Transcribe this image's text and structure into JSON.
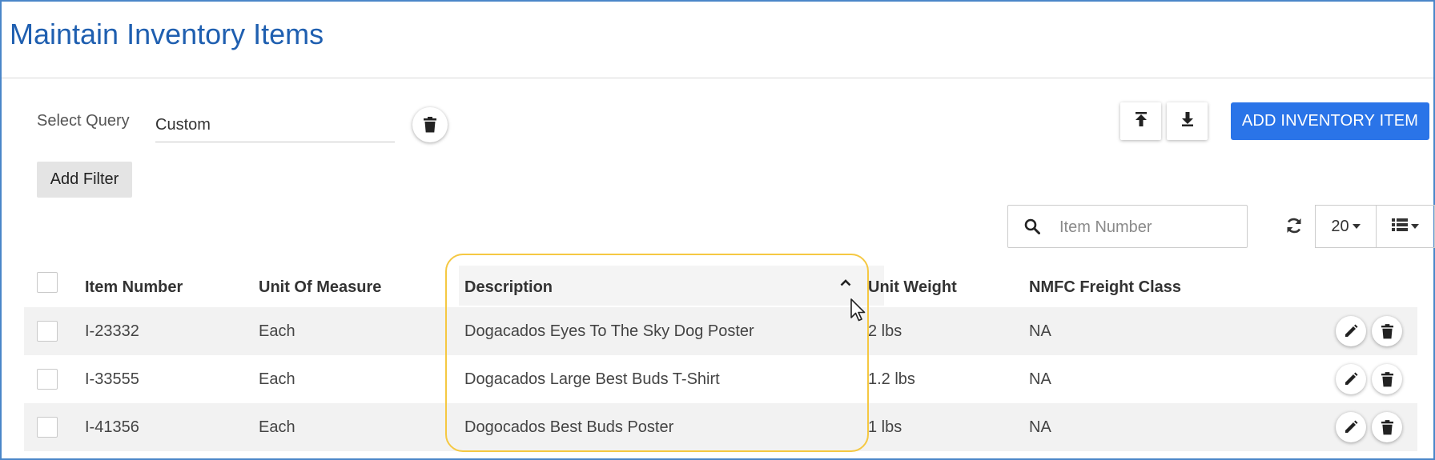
{
  "page": {
    "title": "Maintain Inventory Items"
  },
  "query": {
    "label": "Select Query",
    "value": "Custom",
    "delete_icon": "trash-icon"
  },
  "filters": {
    "add_filter_label": "Add Filter"
  },
  "toolbar": {
    "upload_icon": "upload-icon",
    "download_icon": "download-icon",
    "add_item_label": "ADD INVENTORY ITEM"
  },
  "search": {
    "placeholder": "Item Number",
    "icon": "search-icon"
  },
  "table_controls": {
    "refresh_icon": "refresh-icon",
    "page_size": "20",
    "view_icon": "list-icon"
  },
  "table": {
    "columns": {
      "item_number": "Item Number",
      "unit_of_measure": "Unit Of Measure",
      "description": "Description",
      "unit_weight": "Unit Weight",
      "nmfc_freight_class": "NMFC Freight Class"
    },
    "sorted_column": "description",
    "sort_direction": "ascending",
    "rows": [
      {
        "item_number": "I-23332",
        "unit_of_measure": "Each",
        "description": "Dogacados Eyes To The Sky Dog Poster",
        "unit_weight": "2 lbs",
        "nmfc_freight_class": "NA"
      },
      {
        "item_number": "I-33555",
        "unit_of_measure": "Each",
        "description": "Dogacados Large Best Buds T-Shirt",
        "unit_weight": "1.2 lbs",
        "nmfc_freight_class": "NA"
      },
      {
        "item_number": "I-41356",
        "unit_of_measure": "Each",
        "description": "Dogocados Best Buds Poster",
        "unit_weight": "1 lbs",
        "nmfc_freight_class": "NA"
      }
    ]
  },
  "colors": {
    "title": "#1f5fb0",
    "primary_button": "#2a74e8",
    "highlight": "#f5c842",
    "alt_row": "#f2f2f2"
  }
}
